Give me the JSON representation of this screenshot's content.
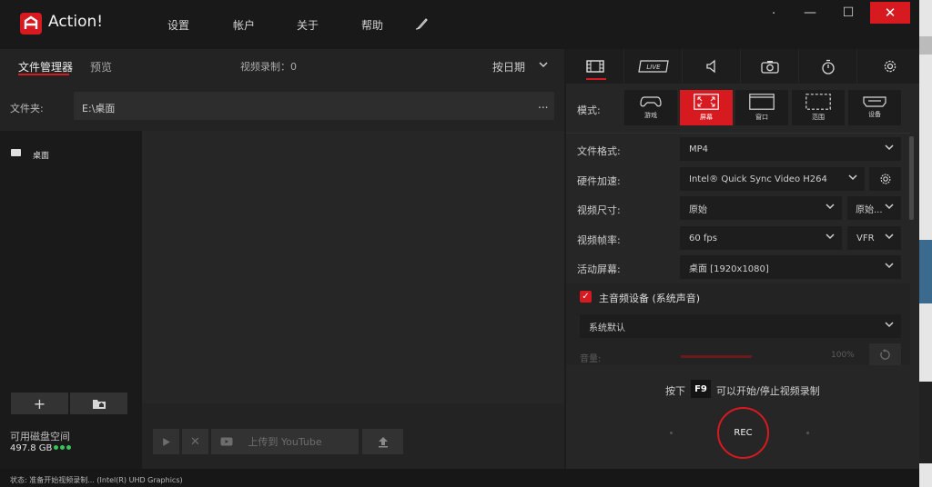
{
  "app": {
    "title": "Action!"
  },
  "nav": {
    "settings": "设置",
    "account": "帐户",
    "about": "关于",
    "help": "帮助"
  },
  "window_controls": {
    "minimize": "—",
    "maximize": "☐",
    "close": "✕"
  },
  "left": {
    "tabs": {
      "file_manager": "文件管理器",
      "preview": "预览"
    },
    "video_count_label": "视频录制：",
    "video_count": "0",
    "sort": "按日期",
    "folder_label": "文件夹:",
    "folder_path": "E:\\桌面",
    "folder_more": "...",
    "tree": [
      {
        "label": "桌面"
      }
    ],
    "disk_label": "可用磁盘空间",
    "disk_value": "497.8 GB",
    "upload_label": "上传到 YouTube"
  },
  "right": {
    "mode_label": "模式:",
    "modes": [
      {
        "label": "游戏"
      },
      {
        "label": "屏幕",
        "active": true
      },
      {
        "label": "窗口"
      },
      {
        "label": "范围"
      },
      {
        "label": "设备"
      }
    ],
    "settings": {
      "file_format_label": "文件格式:",
      "file_format": "MP4",
      "hw_accel_label": "硬件加速:",
      "hw_accel": "Intel® Quick Sync Video H264",
      "video_size_label": "视频尺寸:",
      "video_size": "原始",
      "video_size_2": "原始...",
      "frame_rate_label": "视频帧率:",
      "frame_rate": "60 fps",
      "frame_rate_mode": "VFR",
      "active_screen_label": "活动屏幕:",
      "active_screen": "桌面 [1920x1080]"
    },
    "audio": {
      "title": "主音频设备 (系统声音)",
      "device": "系统默认",
      "volume_label": "音量:",
      "volume_value": "100%",
      "volume_level": 1.0
    },
    "hint_pre": "按下",
    "hotkey": "F9",
    "hint_post": "可以开始/停止视频录制",
    "rec_label": "REC"
  },
  "status": {
    "text": "状态:    准备开始视频录制...  (Intel(R) UHD Graphics)"
  },
  "colors": {
    "accent": "#d71920",
    "disk_ok": "#39c35a"
  }
}
